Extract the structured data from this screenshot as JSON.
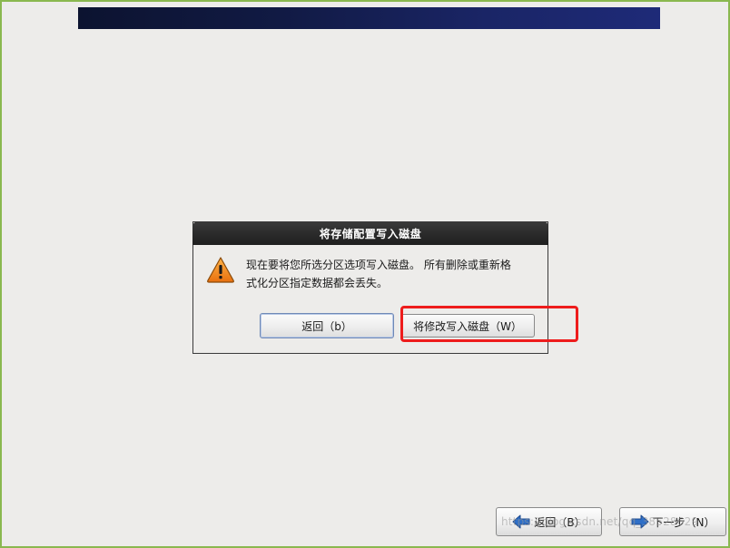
{
  "dialog": {
    "title": "将存储配置写入磁盘",
    "message_line1": "现在要将您所选分区选项写入磁盘。 所有删除或重新格",
    "message_line2": "式化分区指定数据都会丢失。",
    "back_button": "返回（b）",
    "write_button": "将修改写入磁盘（W）"
  },
  "nav": {
    "back_button": "返回（B）",
    "next_button": "下一步（N）"
  },
  "watermark": "https://blog.csdn.net/qq_38528629",
  "colors": {
    "banner": "#111a44",
    "highlight": "#ee1c1c",
    "arrow_blue": "#2f6fc7",
    "warning_orange": "#f18a1b"
  },
  "icons": {
    "dialog": "warning-icon",
    "nav_back": "arrow-left-icon",
    "nav_next": "arrow-right-icon"
  }
}
